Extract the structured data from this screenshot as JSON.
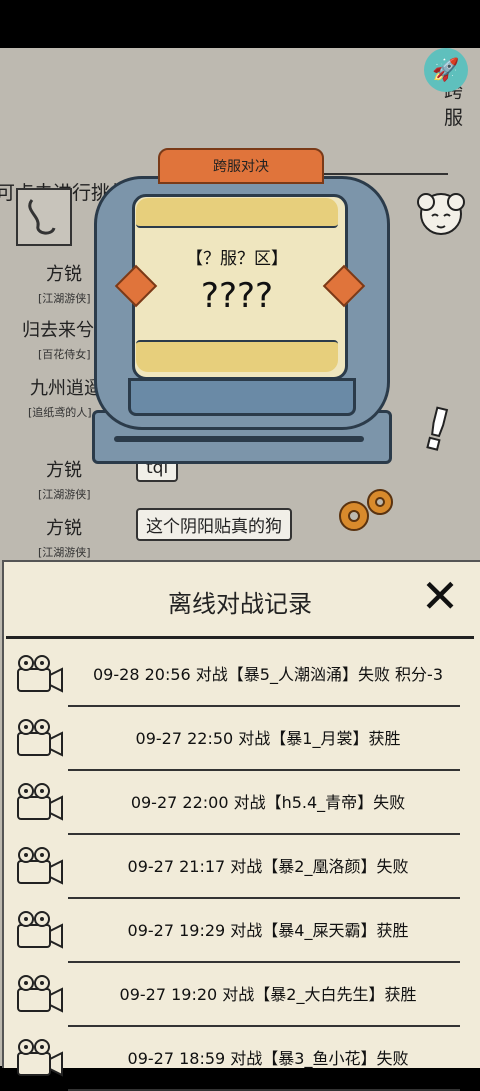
{
  "fab_icon": "rocket-icon",
  "cross_server_tab": "跨服",
  "hint": "可点击进行挑战。",
  "machine": {
    "header": "跨服对决",
    "server_label": "【？服？区】",
    "server_name": "????"
  },
  "chat": [
    {
      "name": "方锐",
      "title": "[江湖游侠]"
    },
    {
      "name": "归去来兮",
      "title": "[百花侍女]"
    },
    {
      "name": "九州逍遥",
      "title": "[追纸鸢的人]"
    },
    {
      "name": "方锐",
      "title": "[江湖游侠]",
      "message": "tql"
    },
    {
      "name": "方锐",
      "title": "[江湖游侠]",
      "message": "这个阴阳贴真的狗"
    }
  ],
  "panel": {
    "title": "离线对战记录",
    "close_icon": "close-icon",
    "records": [
      {
        "text": "09-28 20:56 对战【暴5_人潮汹涌】失败 积分-3"
      },
      {
        "text": "09-27 22:50 对战【暴1_月裳】获胜"
      },
      {
        "text": "09-27 22:00 对战【h5.4_青帝】失败"
      },
      {
        "text": "09-27 21:17 对战【暴2_凰洛颜】失败"
      },
      {
        "text": "09-27 19:29 对战【暴4_屎天霸】获胜"
      },
      {
        "text": "09-27 19:20 对战【暴2_大白先生】获胜"
      },
      {
        "text": "09-27 18:59 对战【暴3_鱼小花】失败"
      }
    ]
  }
}
